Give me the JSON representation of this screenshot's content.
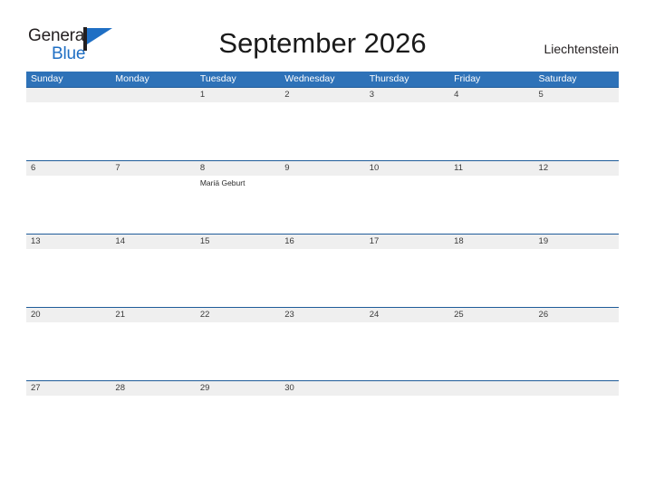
{
  "brand": {
    "name_part1": "General",
    "name_part2": "Blue",
    "logo_icon": "flag-triangle-icon",
    "color_dark": "#231f20",
    "color_blue": "#1f6fc4"
  },
  "header": {
    "title": "September 2026",
    "country": "Liechtenstein"
  },
  "calendar": {
    "header_color": "#2e72b8",
    "row_border_color": "#1f5c99",
    "date_band_color": "#efefef",
    "weekdays": [
      "Sunday",
      "Monday",
      "Tuesday",
      "Wednesday",
      "Thursday",
      "Friday",
      "Saturday"
    ],
    "weeks": [
      {
        "days": [
          {
            "date": "",
            "event": ""
          },
          {
            "date": "",
            "event": ""
          },
          {
            "date": "1",
            "event": ""
          },
          {
            "date": "2",
            "event": ""
          },
          {
            "date": "3",
            "event": ""
          },
          {
            "date": "4",
            "event": ""
          },
          {
            "date": "5",
            "event": ""
          }
        ]
      },
      {
        "days": [
          {
            "date": "6",
            "event": ""
          },
          {
            "date": "7",
            "event": ""
          },
          {
            "date": "8",
            "event": "Mariä Geburt"
          },
          {
            "date": "9",
            "event": ""
          },
          {
            "date": "10",
            "event": ""
          },
          {
            "date": "11",
            "event": ""
          },
          {
            "date": "12",
            "event": ""
          }
        ]
      },
      {
        "days": [
          {
            "date": "13",
            "event": ""
          },
          {
            "date": "14",
            "event": ""
          },
          {
            "date": "15",
            "event": ""
          },
          {
            "date": "16",
            "event": ""
          },
          {
            "date": "17",
            "event": ""
          },
          {
            "date": "18",
            "event": ""
          },
          {
            "date": "19",
            "event": ""
          }
        ]
      },
      {
        "days": [
          {
            "date": "20",
            "event": ""
          },
          {
            "date": "21",
            "event": ""
          },
          {
            "date": "22",
            "event": ""
          },
          {
            "date": "23",
            "event": ""
          },
          {
            "date": "24",
            "event": ""
          },
          {
            "date": "25",
            "event": ""
          },
          {
            "date": "26",
            "event": ""
          }
        ]
      },
      {
        "days": [
          {
            "date": "27",
            "event": ""
          },
          {
            "date": "28",
            "event": ""
          },
          {
            "date": "29",
            "event": ""
          },
          {
            "date": "30",
            "event": ""
          },
          {
            "date": "",
            "event": ""
          },
          {
            "date": "",
            "event": ""
          },
          {
            "date": "",
            "event": ""
          }
        ]
      }
    ]
  }
}
